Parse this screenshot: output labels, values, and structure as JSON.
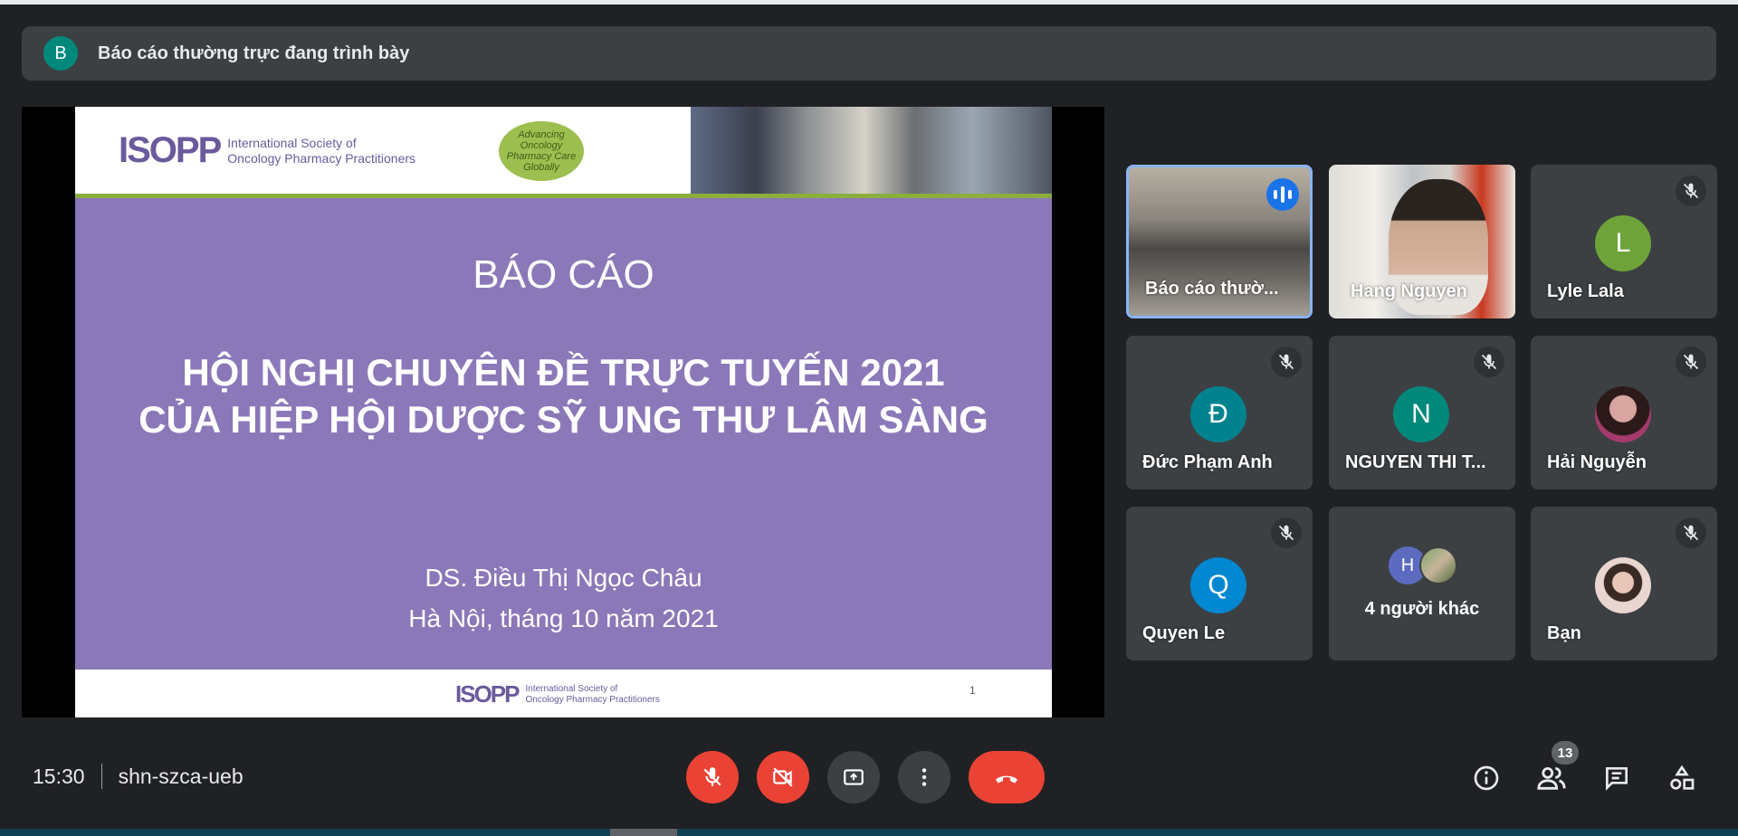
{
  "banner": {
    "avatar_letter": "B",
    "text": "Báo cáo thường trực đang trình bày"
  },
  "slide": {
    "org_mark": "ISOPP",
    "org_name_line1": "International Society of",
    "org_name_line2": "Oncology Pharmacy Practitioners",
    "badge_text": "Advancing Oncology Pharmacy Care Globally",
    "title": "BÁO CÁO",
    "line1": "HỘI NGHỊ CHUYÊN ĐỀ TRỰC TUYẾN 2021",
    "line2": "CỦA HIỆP HỘI DƯỢC SỸ UNG THƯ LÂM SÀNG",
    "author": "DS. Điều Thị Ngọc Châu",
    "place_date": "Hà Nội, tháng 10 năm 2021",
    "page_number": "1"
  },
  "participants": [
    {
      "name": "Báo cáo thườ...",
      "type": "video",
      "speaking": true
    },
    {
      "name": "Hang Nguyen",
      "type": "video",
      "speaking": false
    },
    {
      "name": "Lyle Lala",
      "type": "initial",
      "initial": "L",
      "color": "#6ea33a",
      "muted": true
    },
    {
      "name": "Đức Phạm Anh",
      "type": "initial",
      "initial": "Đ",
      "color": "#00838f",
      "muted": true
    },
    {
      "name": "NGUYEN THI T...",
      "type": "initial",
      "initial": "N",
      "color": "#00897b",
      "muted": true
    },
    {
      "name": "Hải Nguyễn",
      "type": "photo",
      "muted": true
    },
    {
      "name": "Quyen Le",
      "type": "initial",
      "initial": "Q",
      "color": "#0288d1",
      "muted": true
    },
    {
      "name": "4 người khác",
      "type": "others",
      "initial": "H",
      "color": "#5c6bc0"
    },
    {
      "name": "Bạn",
      "type": "photo",
      "muted": true
    }
  ],
  "meeting": {
    "time": "15:30",
    "code": "shn-szca-ueb",
    "participant_count": "13"
  },
  "colors": {
    "danger": "#ea4335",
    "accent": "#1a73e8",
    "surface": "#3c4043",
    "background": "#202124"
  }
}
